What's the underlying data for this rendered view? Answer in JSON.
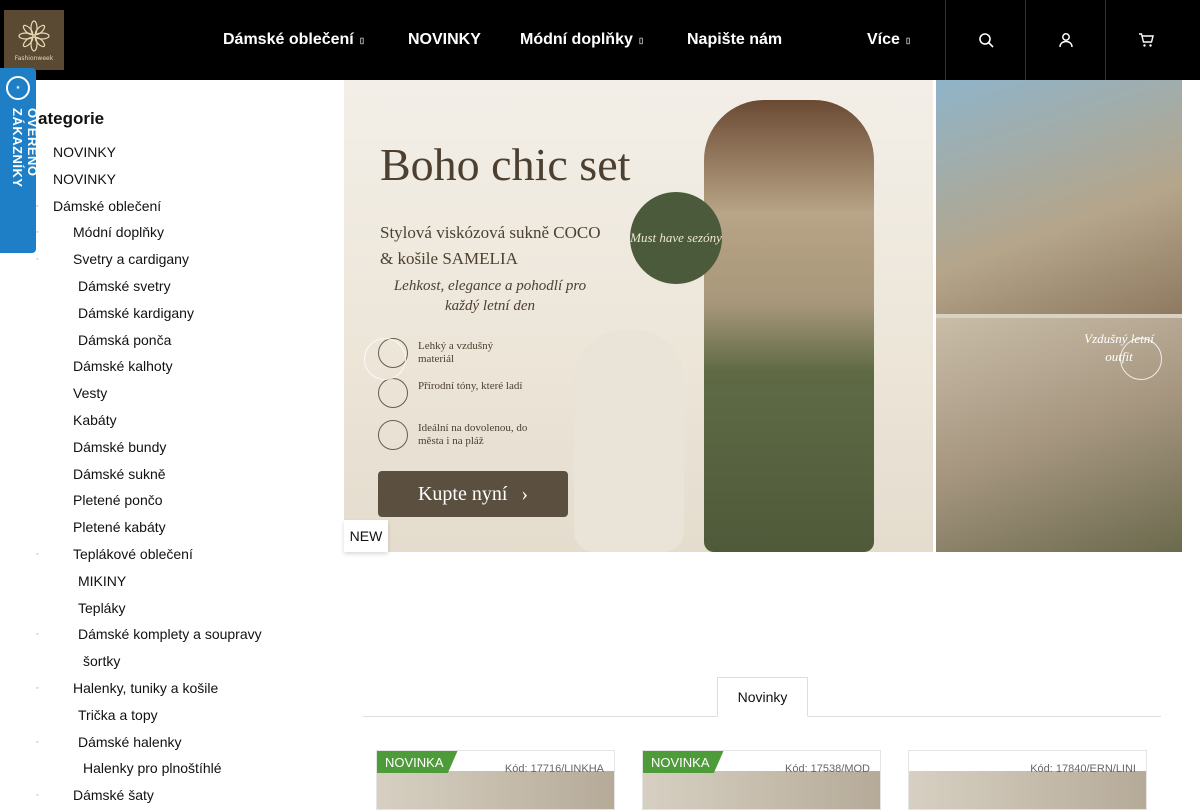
{
  "header": {
    "logo_text": "Fashionweek",
    "nav": [
      {
        "label": "Dámské oblečení",
        "caret": "▯"
      },
      {
        "label": "NOVINKY",
        "caret": ""
      },
      {
        "label": "Módní doplňky",
        "caret": "▯"
      },
      {
        "label": "Napište nám",
        "caret": ""
      },
      {
        "label": "Více",
        "caret": "▯"
      }
    ],
    "icons": [
      "search-icon",
      "user-icon",
      "cart-icon"
    ]
  },
  "badge": {
    "text": "OVĚŘENO ZÁKAZNÍKY"
  },
  "sidebar": {
    "title": "ategorie",
    "items": [
      {
        "label": "NOVINKY",
        "bullet": false
      },
      {
        "label": "NOVINKY",
        "bullet": false
      },
      {
        "label": "Dámské oblečení",
        "bullet": true
      },
      {
        "label": "Módní doplňky",
        "bullet": true
      },
      {
        "label": "Svetry a cardigany",
        "bullet": true
      },
      {
        "label": "Dámské svetry",
        "bullet": false
      },
      {
        "label": "Dámské kardigany",
        "bullet": false
      },
      {
        "label": "Dámská ponča",
        "bullet": false
      },
      {
        "label": "Dámské kalhoty",
        "bullet": false
      },
      {
        "label": "Vesty",
        "bullet": false
      },
      {
        "label": "Kabáty",
        "bullet": false
      },
      {
        "label": "Dámské bundy",
        "bullet": false
      },
      {
        "label": "Dámské sukně",
        "bullet": false
      },
      {
        "label": "Pletené pončo",
        "bullet": false
      },
      {
        "label": "Pletené kabáty",
        "bullet": false
      },
      {
        "label": "Teplákové oblečení",
        "bullet": true
      },
      {
        "label": "MIKINY",
        "bullet": false
      },
      {
        "label": "Tepláky",
        "bullet": false
      },
      {
        "label": "Dámské komplety a soupravy",
        "bullet": true
      },
      {
        "label": "šortky",
        "bullet": false
      },
      {
        "label": "Halenky, tuniky a košile",
        "bullet": true
      },
      {
        "label": "Trička a topy",
        "bullet": false
      },
      {
        "label": "Dámské halenky",
        "bullet": true
      },
      {
        "label": "Halenky pro plnoštíhlé",
        "bullet": false
      },
      {
        "label": "Dámské šaty",
        "bullet": true
      }
    ]
  },
  "banner": {
    "title": "Boho chic set",
    "subtitle": "Stylová viskózová sukně COCO & košile SAMELIA",
    "tagline": "Lehkost, elegance a pohodlí pro každý letní den",
    "must_have": "Must have sezóny",
    "features": [
      "Lehký a vzdušný materiál",
      "Přírodní tóny, které ladí",
      "Ideální na dovolenou, do města i na pláž"
    ],
    "cta": "Kupte nyní",
    "side_text": "Vzdušný letní outfit",
    "new_tag": "NEW"
  },
  "tabs": [
    {
      "label": "Novinky"
    }
  ],
  "products": [
    {
      "label": "NOVINKA",
      "code": "Kód: 17716/LINKHA"
    },
    {
      "label": "NOVINKA",
      "code": "Kód: 17538/MOD"
    },
    {
      "label": "",
      "code": "Kód: 17840/ERN/LINI"
    }
  ]
}
